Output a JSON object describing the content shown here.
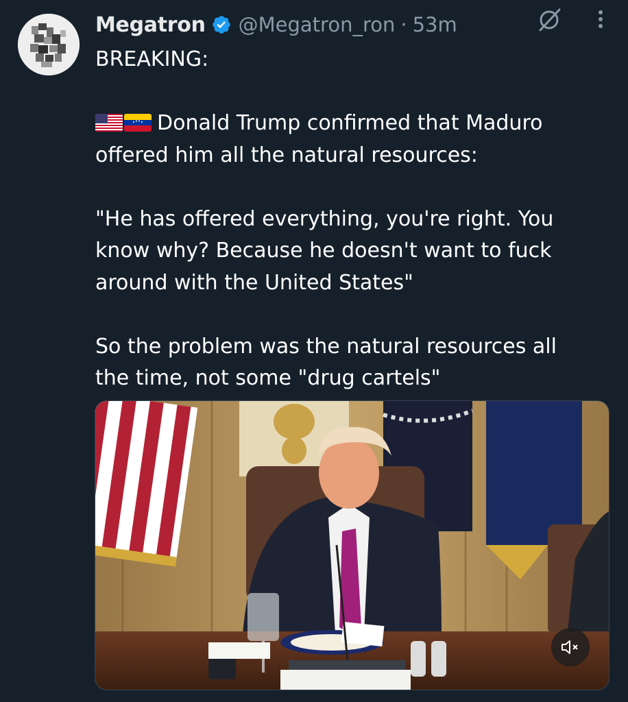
{
  "user": {
    "name": "Megatron",
    "handle": "@Megatron_ron",
    "separator": "·",
    "time": "53m"
  },
  "colors": {
    "background": "#15202b",
    "verified": "#1d9bf0",
    "secondary_text": "#8b98a5"
  },
  "icons": [
    "verified-badge-icon",
    "grok-icon",
    "more-options-icon",
    "us-flag-icon",
    "venezuela-flag-icon",
    "mute-icon"
  ],
  "tweet": {
    "line1": "BREAKING:",
    "line2": "Donald Trump confirmed that Maduro",
    "line3": "offered him all the natural resources:",
    "line4": "\"He has offered everything, you're right. You",
    "line5": "know why? Because he doesn't want to fuck",
    "line6": "around with the United States\"",
    "line7": "So the problem was the natural resources all",
    "line8": "the time, not some \"drug cartels\""
  }
}
